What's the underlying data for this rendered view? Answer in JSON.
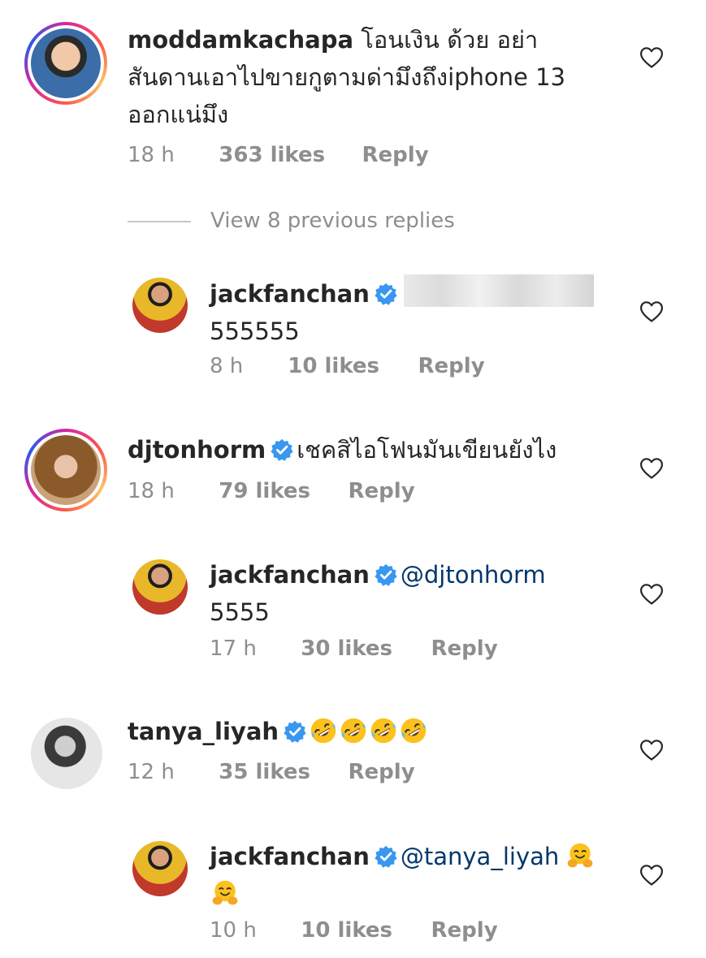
{
  "comments": [
    {
      "username": "moddamkachapa",
      "text_line1": "โอนเงิน ด้วย อย่า",
      "text_line2": "สันดานเอาไปขายกูตามด่ามึงถึงiphone 13",
      "text_line3": "ออกแน่มึง",
      "time": "18 h",
      "likes": "363 likes",
      "reply": "Reply"
    },
    {
      "username": "jackfanchan",
      "text": "555555",
      "time": "8 h",
      "likes": "10 likes",
      "reply": "Reply"
    },
    {
      "username": "djtonhorm",
      "text": "เชคสิไอโฟนมันเขียนยังไง",
      "time": "18 h",
      "likes": "79 likes",
      "reply": "Reply"
    },
    {
      "username": "jackfanchan",
      "mention": "@djtonhorm",
      "text": "5555",
      "time": "17 h",
      "likes": "30 likes",
      "reply": "Reply"
    },
    {
      "username": "tanya_liyah",
      "time": "12 h",
      "likes": "35 likes",
      "reply": "Reply"
    },
    {
      "username": "jackfanchan",
      "mention": "@tanya_liyah",
      "time": "10 h",
      "likes": "10 likes",
      "reply": "Reply"
    }
  ],
  "view_replies": "View 8 previous replies",
  "icons": {
    "heart": "heart-outline-icon",
    "verified": "verified-badge-icon",
    "laugh_emoji": "rolling-on-floor-laughing-emoji",
    "hug_emoji": "hugging-face-emoji"
  },
  "colors": {
    "text": "#262626",
    "muted": "#8e8e8e",
    "verified": "#3897f0",
    "mention": "#00376b"
  }
}
